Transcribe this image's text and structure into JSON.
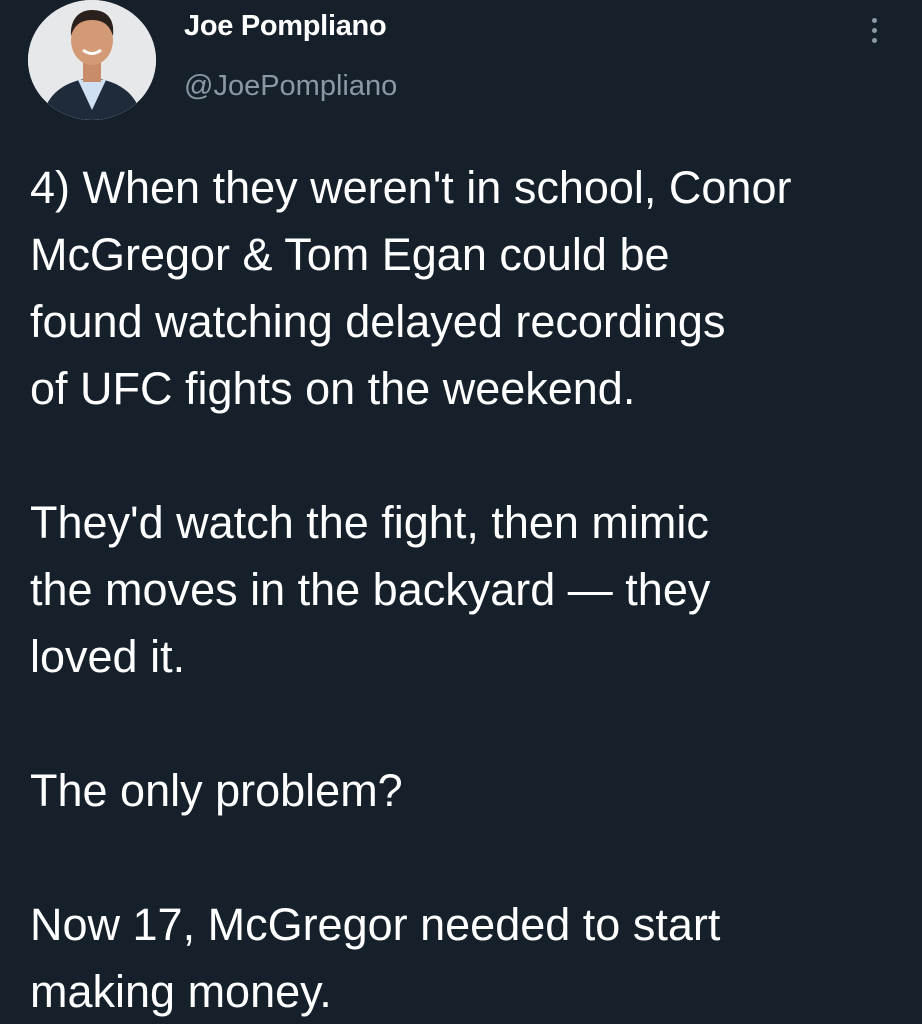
{
  "author": {
    "name": "Joe Pompliano",
    "handle": "@JoePompliano",
    "avatar_icon": "profile-photo"
  },
  "menu": {
    "icon": "more-vertical-icon"
  },
  "tweet": {
    "paragraphs": [
      "4) When they weren't in school, Conor\nMcGregor & Tom Egan could be\nfound watching delayed recordings\nof UFC fights on the weekend.",
      "They'd watch the fight, then mimic\nthe moves in the backyard — they\nloved it.",
      "The only problem?",
      "Now 17, McGregor needed to start\nmaking money."
    ]
  },
  "colors": {
    "background": "#15202b",
    "primary_text": "#ffffff",
    "secondary_text": "#8b98a5"
  }
}
